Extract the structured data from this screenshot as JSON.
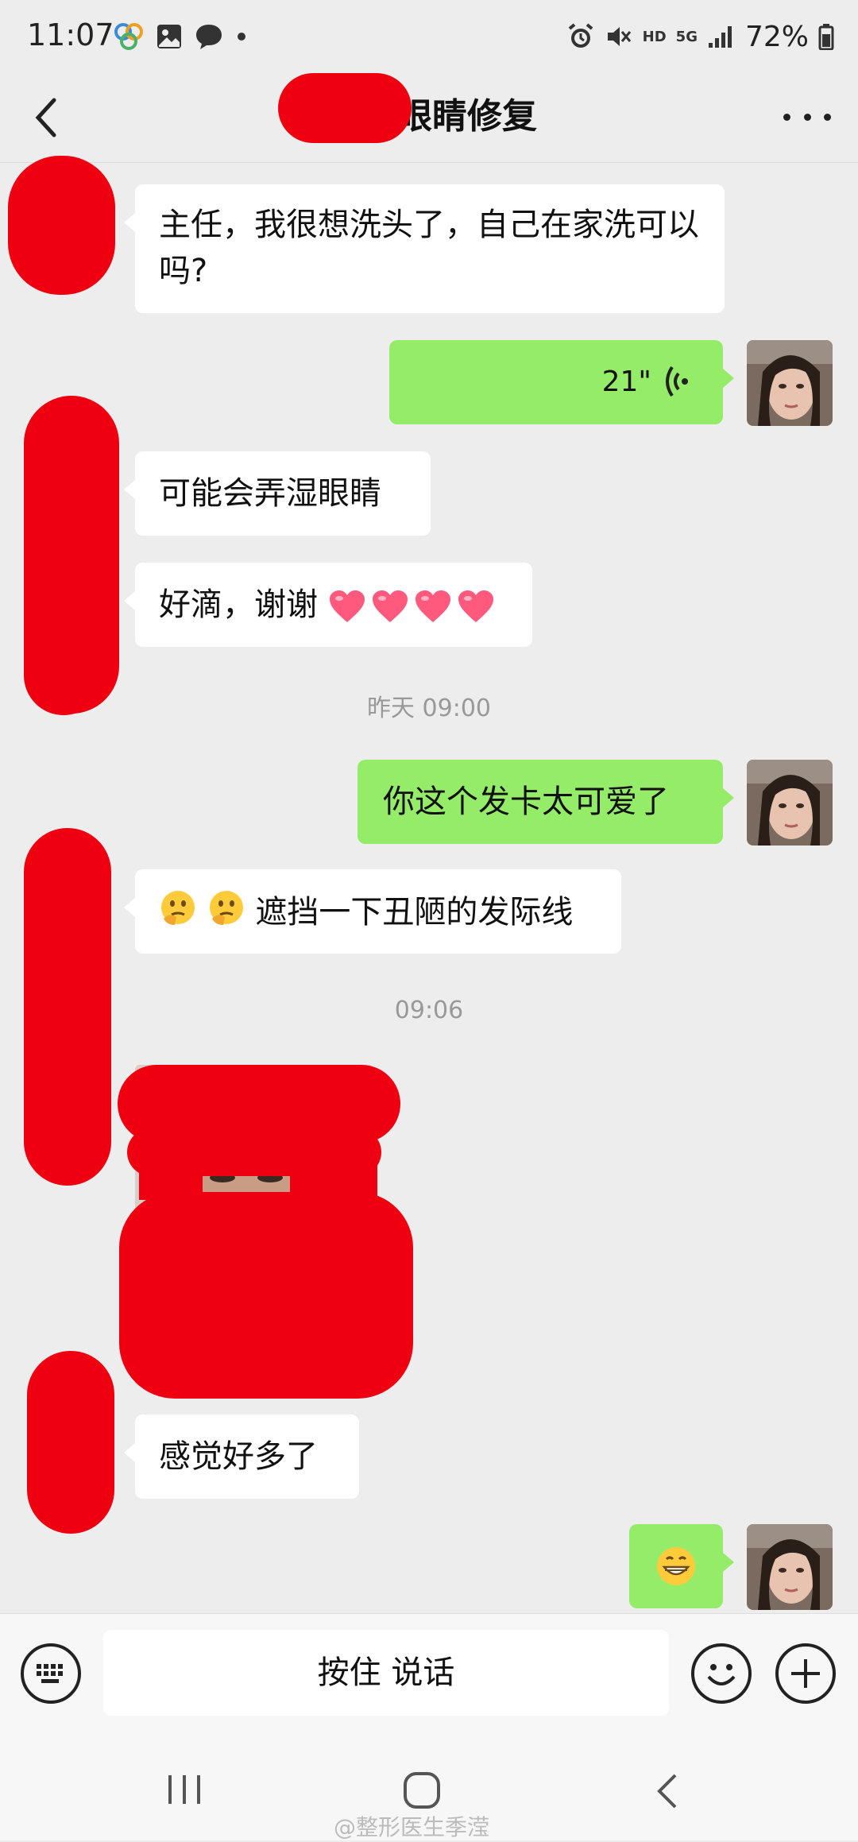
{
  "status_bar": {
    "time": "11:07",
    "hd": "HD",
    "network": "5G",
    "battery": "72%",
    "left_icons": [
      "app-cluster-icon",
      "gallery-icon",
      "message-icon",
      "dot-icon"
    ],
    "right_icons": [
      "alarm-icon",
      "mute-icon",
      "signal-icon",
      "battery-icon"
    ]
  },
  "nav": {
    "title": "眼睛修复",
    "back_icon": "chevron-left-icon",
    "more_icon": "more-dots-icon"
  },
  "messages": [
    {
      "side": "in",
      "text": "主任，我很想洗头了，自己在家洗可以吗?"
    },
    {
      "side": "out",
      "type": "voice",
      "duration": "21\""
    },
    {
      "side": "in",
      "text": "可能会弄湿眼睛"
    },
    {
      "side": "in",
      "text": "好滴，谢谢",
      "trailing": "heart-emoji x4"
    },
    {
      "type": "time",
      "text": "昨天 09:00"
    },
    {
      "side": "out",
      "text": "你这个发卡太可爱了"
    },
    {
      "side": "in",
      "leading": "thinking-emoji x2",
      "text": "遮挡一下丑陋的发际线"
    },
    {
      "type": "time",
      "text": "09:06"
    },
    {
      "side": "in",
      "type": "image"
    },
    {
      "side": "in",
      "text": "感觉好多了"
    },
    {
      "side": "out",
      "type": "emoji",
      "emoji": "grin-emoji"
    }
  ],
  "input_bar": {
    "hold_to_talk": "按住 说话",
    "keyboard_icon": "keyboard-icon",
    "emoji_icon": "smiley-icon",
    "plus_icon": "plus-icon"
  },
  "system_nav": {
    "icons": [
      "recents-icon",
      "home-icon",
      "back-icon"
    ]
  },
  "watermark": "@整形医生季滢",
  "colors": {
    "background": "#ededed",
    "bubble_out": "#95ec69",
    "bubble_in": "#ffffff",
    "redaction": "#ef0010"
  }
}
